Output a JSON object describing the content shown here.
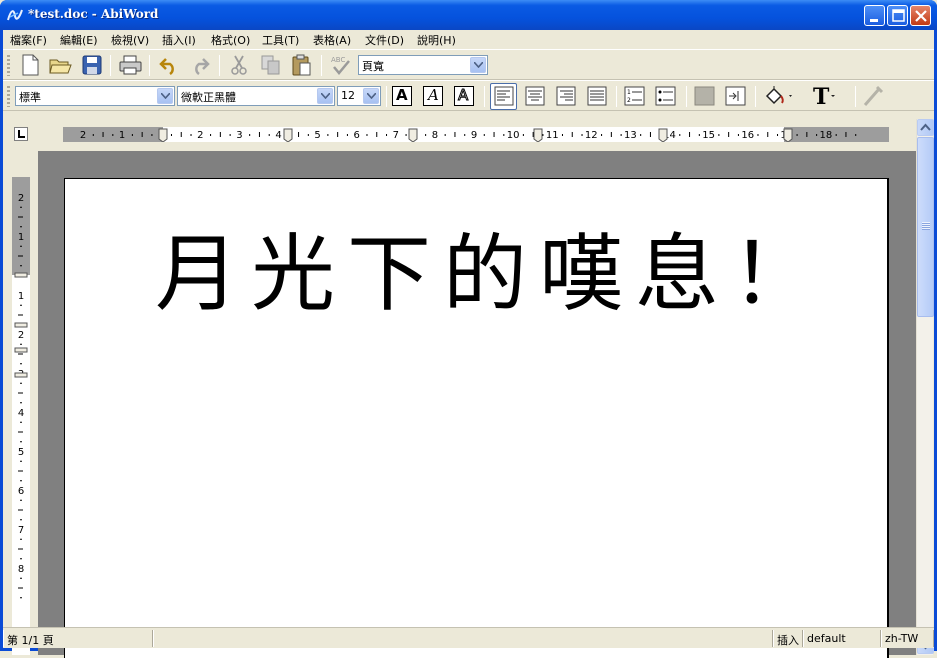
{
  "window": {
    "title": "*test.doc - AbiWord",
    "app_icon": "abiword-icon"
  },
  "menubar": {
    "items": [
      {
        "label": "檔案(F)"
      },
      {
        "label": "編輯(E)"
      },
      {
        "label": "檢視(V)"
      },
      {
        "label": "插入(I)"
      },
      {
        "label": "格式(O)"
      },
      {
        "label": "工具(T)"
      },
      {
        "label": "表格(A)"
      },
      {
        "label": "文件(D)"
      },
      {
        "label": "說明(H)"
      }
    ]
  },
  "toolbar_standard": {
    "zoom_value": "頁寬"
  },
  "toolbar_format": {
    "style_value": "標準",
    "font_value": "微軟正黑體",
    "size_value": "12",
    "bold_label": "A",
    "italic_label": "A",
    "underline_label": "A",
    "text_color_label": "T"
  },
  "ruler": {
    "h_ticks": [
      "2",
      "1",
      "1",
      "2",
      "3",
      "4",
      "5",
      "6",
      "7",
      "8",
      "9",
      "10",
      "11",
      "12",
      "13",
      "14",
      "15",
      "16",
      "17",
      "18"
    ],
    "v_ticks": [
      "2",
      "1",
      "1",
      "2",
      "3",
      "4",
      "5",
      "6",
      "7",
      "8"
    ]
  },
  "document": {
    "text": "月光下的嘆息！"
  },
  "statusbar": {
    "page": "第 1/1 頁",
    "mode": "插入",
    "style": "default",
    "lang": "zh-TW"
  }
}
